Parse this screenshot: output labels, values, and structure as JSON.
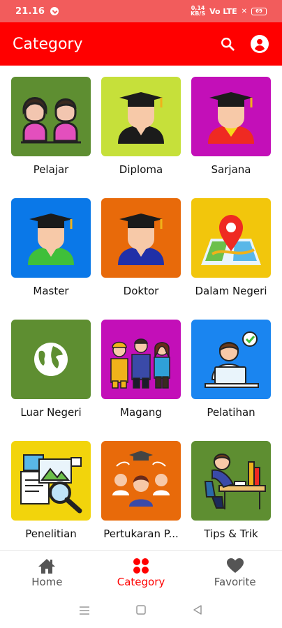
{
  "status_bar": {
    "time": "21.16",
    "speed_top": "0,14",
    "speed_bottom": "KB/S",
    "signal": "Vo LTE",
    "battery": "69"
  },
  "app_bar": {
    "title": "Category"
  },
  "categories": [
    {
      "label": "Pelajar",
      "bg": "#5e8e31"
    },
    {
      "label": "Diploma",
      "bg": "#c6e03a"
    },
    {
      "label": "Sarjana",
      "bg": "#c30fb8"
    },
    {
      "label": "Master",
      "bg": "#0a78e8"
    },
    {
      "label": "Doktor",
      "bg": "#e86a0a"
    },
    {
      "label": "Dalam Negeri",
      "bg": "#f2c60c"
    },
    {
      "label": "Luar Negeri",
      "bg": "#5e8e31"
    },
    {
      "label": "Magang",
      "bg": "#c30fb8"
    },
    {
      "label": "Pelatihan",
      "bg": "#1a85f0"
    },
    {
      "label": "Penelitian",
      "bg": "#f2d40c"
    },
    {
      "label": "Pertukaran P...",
      "bg": "#e86a0a"
    },
    {
      "label": "Tips & Trik",
      "bg": "#5e8e31"
    }
  ],
  "bottom_nav": {
    "items": [
      {
        "label": "Home",
        "icon": "home-icon"
      },
      {
        "label": "Category",
        "icon": "category-icon"
      },
      {
        "label": "Favorite",
        "icon": "heart-icon"
      }
    ],
    "active": "Category"
  },
  "colors": {
    "primary": "#ff0000",
    "status_bar": "#f25c5c"
  }
}
